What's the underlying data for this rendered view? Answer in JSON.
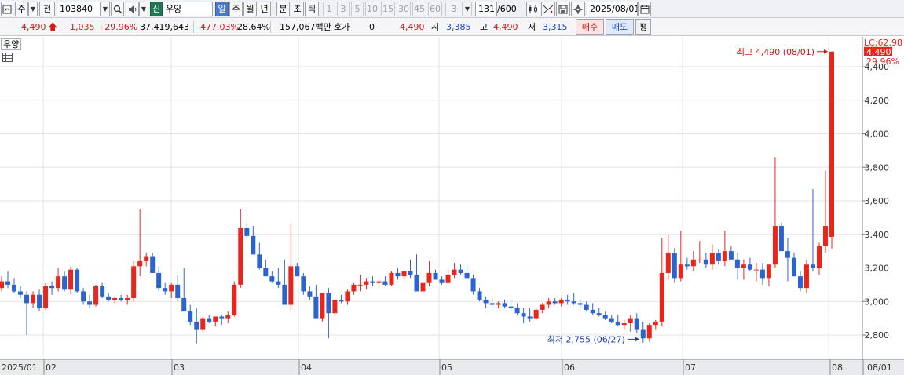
{
  "toolbar": {
    "market_type": "주",
    "prev_label": "전",
    "stock_code": "103840",
    "realtime_badge": "신",
    "stock_name": "우양",
    "periods": [
      "일",
      "주",
      "월",
      "년",
      "분",
      "초",
      "틱"
    ],
    "active_period": "일",
    "intervals": [
      "1",
      "3",
      "5",
      "10",
      "15",
      "30",
      "45",
      "60"
    ],
    "custom_interval": "3",
    "count_value": "131",
    "count_max": "/600",
    "date_value": "2025/08/01"
  },
  "quote": {
    "price": "4,490",
    "change": "1,035",
    "change_rate": "+29.96%",
    "volume": "37,419,643",
    "volume_ratio": "477.03%",
    "turnover": "28.64%",
    "amount": "157,067백만",
    "hoga_label": "호가",
    "hoga_value": "0",
    "hoga_price": "4,490",
    "open_label": "시",
    "open": "3,385",
    "high_label": "고",
    "high": "4,490",
    "low_label": "저",
    "low": "3,315",
    "buy_label": "매수",
    "sell_label": "매도",
    "avg_label": "평"
  },
  "chart_data": {
    "type": "candlestick",
    "title": "우양",
    "up_color": "#e8261c",
    "down_color": "#2c64cf",
    "y_ticks": [
      2800,
      3000,
      3200,
      3400,
      3600,
      3800,
      4000,
      4200,
      4400
    ],
    "y_tick_labels": [
      "2,800",
      "3,000",
      "3,200",
      "3,400",
      "3,600",
      "3,800",
      "4,000",
      "4,200",
      "4,400"
    ],
    "ylim": [
      2700,
      4520
    ],
    "x_labels": [
      "2025/01",
      "02",
      "03",
      "04",
      "05",
      "06",
      "07",
      "08",
      "08/01"
    ],
    "last_price_label": "4,490",
    "last_change_label": "29.96%",
    "upper_limit_label": "LC:62.98",
    "high_annotation": "최고 4,490 (08/01)",
    "low_annotation": "최저 2,755 (06/27)",
    "high_value": 4490,
    "low_value": 2755,
    "candles": [
      [
        3080,
        3150,
        3060,
        3120
      ],
      [
        3120,
        3180,
        3080,
        3100
      ],
      [
        3100,
        3140,
        3050,
        3060
      ],
      [
        3060,
        3090,
        3020,
        3040
      ],
      [
        3040,
        3060,
        2800,
        2990
      ],
      [
        2990,
        3060,
        2960,
        3040
      ],
      [
        3040,
        3070,
        2940,
        2960
      ],
      [
        2960,
        3110,
        2950,
        3090
      ],
      [
        3090,
        3120,
        3040,
        3080
      ],
      [
        3080,
        3200,
        3060,
        3150
      ],
      [
        3150,
        3180,
        3060,
        3070
      ],
      [
        3070,
        3210,
        3040,
        3190
      ],
      [
        3190,
        3200,
        3050,
        3060
      ],
      [
        3060,
        3080,
        2980,
        3000
      ],
      [
        3000,
        3040,
        2960,
        2980
      ],
      [
        2980,
        3100,
        2970,
        3090
      ],
      [
        3090,
        3110,
        3020,
        3030
      ],
      [
        3030,
        3050,
        3000,
        3010
      ],
      [
        3010,
        3030,
        2990,
        3020
      ],
      [
        3020,
        3040,
        3000,
        3010
      ],
      [
        3010,
        3040,
        2980,
        3020
      ],
      [
        3020,
        3240,
        3000,
        3210
      ],
      [
        3210,
        3550,
        3150,
        3240
      ],
      [
        3240,
        3290,
        3210,
        3270
      ],
      [
        3270,
        3290,
        3170,
        3170
      ],
      [
        3170,
        3210,
        3060,
        3080
      ],
      [
        3080,
        3110,
        3040,
        3060
      ],
      [
        3060,
        3110,
        3020,
        3100
      ],
      [
        3100,
        3160,
        3000,
        3020
      ],
      [
        3020,
        3200,
        3000,
        2940
      ],
      [
        2940,
        2980,
        2860,
        2880
      ],
      [
        2880,
        2960,
        2750,
        2830
      ],
      [
        2830,
        2910,
        2820,
        2900
      ],
      [
        2900,
        2920,
        2870,
        2880
      ],
      [
        2880,
        2900,
        2850,
        2910
      ],
      [
        2910,
        2920,
        2860,
        2900
      ],
      [
        2900,
        2940,
        2870,
        2920
      ],
      [
        2920,
        3120,
        2910,
        3100
      ],
      [
        3100,
        3550,
        3080,
        3440
      ],
      [
        3440,
        3460,
        3380,
        3390
      ],
      [
        3390,
        3450,
        3280,
        3280
      ],
      [
        3280,
        3350,
        3190,
        3200
      ],
      [
        3200,
        3250,
        3170,
        3150
      ],
      [
        3150,
        3180,
        3110,
        3120
      ],
      [
        3120,
        3200,
        3080,
        3100
      ],
      [
        3100,
        3250,
        3020,
        2980
      ],
      [
        2980,
        3460,
        2950,
        3210
      ],
      [
        3210,
        3230,
        3150,
        3150
      ],
      [
        3150,
        3170,
        3040,
        3060
      ],
      [
        3060,
        3090,
        3010,
        3030
      ],
      [
        3030,
        3100,
        2930,
        2900
      ],
      [
        2900,
        3010,
        2880,
        3050
      ],
      [
        3050,
        3080,
        2780,
        2930
      ],
      [
        2930,
        3000,
        2910,
        3010
      ],
      [
        3010,
        3040,
        2990,
        3000
      ],
      [
        3000,
        3070,
        2980,
        3060
      ],
      [
        3060,
        3110,
        3040,
        3100
      ],
      [
        3100,
        3160,
        3060,
        3100
      ],
      [
        3100,
        3140,
        3070,
        3120
      ],
      [
        3120,
        3150,
        3090,
        3110
      ],
      [
        3110,
        3130,
        3080,
        3120
      ],
      [
        3120,
        3150,
        3090,
        3100
      ],
      [
        3100,
        3180,
        3090,
        3170
      ],
      [
        3170,
        3200,
        3130,
        3150
      ],
      [
        3150,
        3180,
        3120,
        3180
      ],
      [
        3180,
        3250,
        3140,
        3160
      ],
      [
        3160,
        3280,
        3060,
        3060
      ],
      [
        3060,
        3120,
        3050,
        3110
      ],
      [
        3110,
        3240,
        3090,
        3170
      ],
      [
        3170,
        3190,
        3130,
        3130
      ],
      [
        3130,
        3150,
        3100,
        3110
      ],
      [
        3110,
        3190,
        3100,
        3160
      ],
      [
        3160,
        3230,
        3140,
        3190
      ],
      [
        3190,
        3220,
        3160,
        3170
      ],
      [
        3170,
        3220,
        3140,
        3140
      ],
      [
        3140,
        3160,
        3040,
        3060
      ],
      [
        3060,
        3080,
        3000,
        3010
      ],
      [
        3010,
        3030,
        2960,
        2990
      ],
      [
        2990,
        3020,
        2960,
        2980
      ],
      [
        2980,
        3000,
        2960,
        2990
      ],
      [
        2990,
        3010,
        2960,
        2970
      ],
      [
        2970,
        3010,
        2940,
        2960
      ],
      [
        2960,
        2990,
        2920,
        2930
      ],
      [
        2930,
        2960,
        2870,
        2910
      ],
      [
        2910,
        2960,
        2880,
        2900
      ],
      [
        2900,
        2960,
        2890,
        2950
      ],
      [
        2950,
        2990,
        2930,
        2980
      ],
      [
        2980,
        3020,
        2960,
        3000
      ],
      [
        3000,
        3020,
        2980,
        2990
      ],
      [
        2990,
        3020,
        2970,
        3010
      ],
      [
        3010,
        3040,
        2980,
        3000
      ],
      [
        3000,
        3050,
        2980,
        2990
      ],
      [
        2990,
        3010,
        2960,
        2980
      ],
      [
        2980,
        3000,
        2940,
        2950
      ],
      [
        2950,
        2990,
        2920,
        2930
      ],
      [
        2930,
        2960,
        2910,
        2920
      ],
      [
        2920,
        2940,
        2890,
        2900
      ],
      [
        2900,
        2920,
        2870,
        2880
      ],
      [
        2880,
        2920,
        2850,
        2860
      ],
      [
        2860,
        2890,
        2830,
        2870
      ],
      [
        2870,
        2920,
        2820,
        2900
      ],
      [
        2900,
        2930,
        2810,
        2830
      ],
      [
        2830,
        2880,
        2755,
        2780
      ],
      [
        2780,
        2870,
        2760,
        2860
      ],
      [
        2860,
        2890,
        2830,
        2880
      ],
      [
        2880,
        3380,
        2850,
        3170
      ],
      [
        3170,
        3400,
        3130,
        3290
      ],
      [
        3290,
        3320,
        3110,
        3140
      ],
      [
        3140,
        3420,
        3120,
        3220
      ],
      [
        3220,
        3260,
        3190,
        3210
      ],
      [
        3210,
        3300,
        3180,
        3250
      ],
      [
        3250,
        3360,
        3230,
        3250
      ],
      [
        3250,
        3290,
        3200,
        3220
      ],
      [
        3220,
        3340,
        3190,
        3290
      ],
      [
        3290,
        3310,
        3220,
        3240
      ],
      [
        3240,
        3420,
        3210,
        3300
      ],
      [
        3300,
        3330,
        3270,
        3250
      ],
      [
        3250,
        3290,
        3130,
        3200
      ],
      [
        3200,
        3250,
        3130,
        3220
      ],
      [
        3220,
        3260,
        3180,
        3190
      ],
      [
        3190,
        3230,
        3120,
        3190
      ],
      [
        3190,
        3230,
        3100,
        3140
      ],
      [
        3140,
        3180,
        3090,
        3220
      ],
      [
        3220,
        3860,
        3200,
        3450
      ],
      [
        3450,
        3470,
        3350,
        3300
      ],
      [
        3300,
        3380,
        3120,
        3260
      ],
      [
        3260,
        3290,
        3150,
        3150
      ],
      [
        3150,
        3180,
        3060,
        3080
      ],
      [
        3080,
        3250,
        3050,
        3220
      ],
      [
        3220,
        3670,
        3180,
        3200
      ],
      [
        3200,
        3350,
        3160,
        3330
      ],
      [
        3330,
        3780,
        3290,
        3450
      ],
      [
        3385,
        4490,
        3315,
        4490
      ]
    ]
  }
}
